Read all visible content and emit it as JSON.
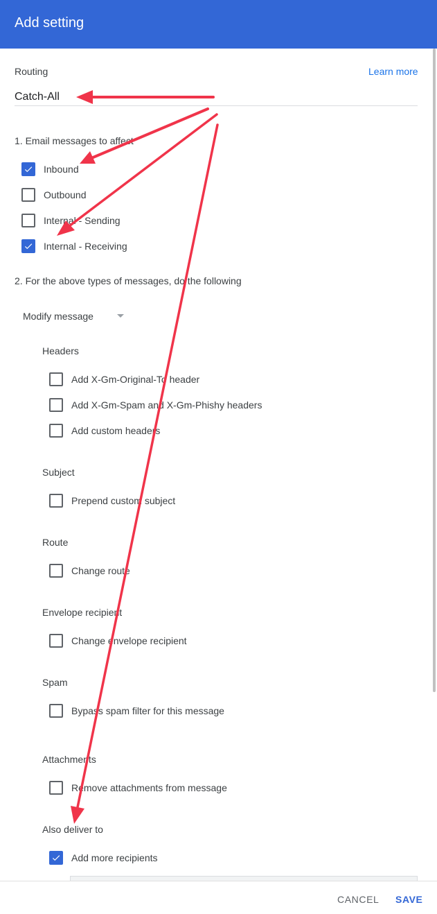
{
  "dialog": {
    "title": "Add setting"
  },
  "routing": {
    "label": "Routing",
    "learn_more": "Learn more",
    "value": "Catch-All"
  },
  "step1": {
    "title": "1. Email messages to affect",
    "options": [
      {
        "label": "Inbound",
        "checked": true
      },
      {
        "label": "Outbound",
        "checked": false
      },
      {
        "label": "Internal - Sending",
        "checked": false
      },
      {
        "label": "Internal - Receiving",
        "checked": true
      }
    ]
  },
  "step2": {
    "title": "2. For the above types of messages, do the following",
    "action": "Modify message"
  },
  "headers": {
    "title": "Headers",
    "options": [
      {
        "label": "Add X-Gm-Original-To header",
        "checked": false
      },
      {
        "label": "Add X-Gm-Spam and X-Gm-Phishy headers",
        "checked": false
      },
      {
        "label": "Add custom headers",
        "checked": false
      }
    ]
  },
  "subject": {
    "title": "Subject",
    "option": {
      "label": "Prepend custom subject",
      "checked": false
    }
  },
  "route": {
    "title": "Route",
    "option": {
      "label": "Change route",
      "checked": false
    }
  },
  "envelope": {
    "title": "Envelope recipient",
    "option": {
      "label": "Change envelope recipient",
      "checked": false
    }
  },
  "spam": {
    "title": "Spam",
    "option": {
      "label": "Bypass spam filter for this message",
      "checked": false
    }
  },
  "attachments": {
    "title": "Attachments",
    "option": {
      "label": "Remove attachments from message",
      "checked": false
    }
  },
  "also_deliver": {
    "title": "Also deliver to",
    "option": {
      "label": "Add more recipients",
      "checked": true
    }
  },
  "footer": {
    "cancel": "CANCEL",
    "save": "SAVE"
  },
  "colors": {
    "header": "#3367d6",
    "accent": "#3367d6",
    "annotation_arrow": "#f0344a"
  }
}
